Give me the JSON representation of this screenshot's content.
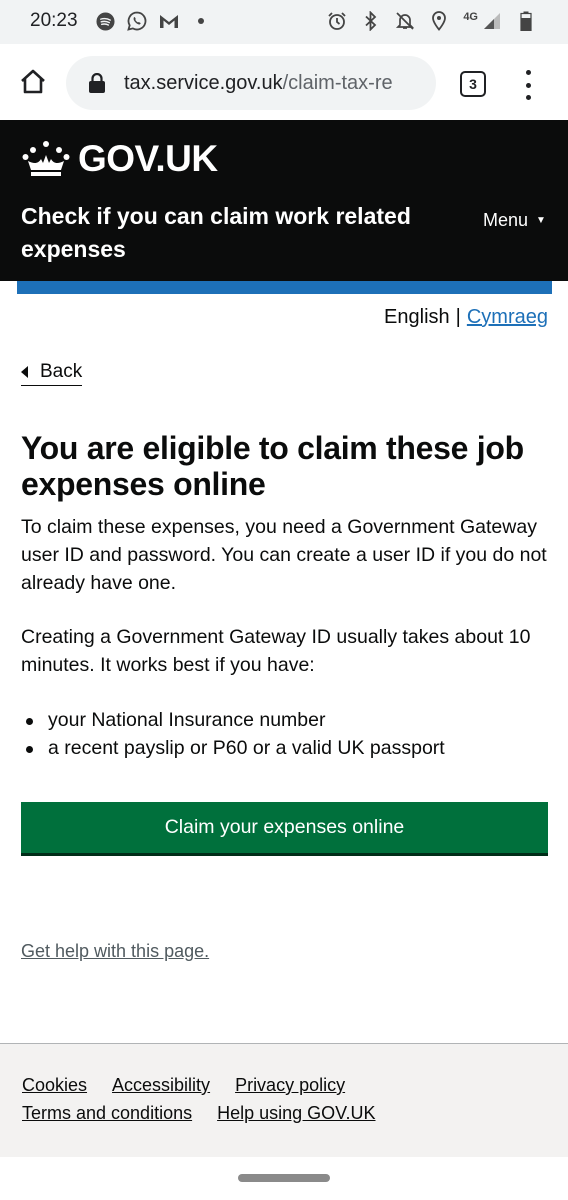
{
  "status_bar": {
    "time": "20:23",
    "network": "4G",
    "battery": "64",
    "left_icons": [
      "spotify-icon",
      "whatsapp-icon",
      "gmail-icon",
      "dot-icon"
    ],
    "right_icons": [
      "alarm-icon",
      "bluetooth-icon",
      "mute-icon",
      "location-icon",
      "signal-icon",
      "battery-icon"
    ]
  },
  "browser": {
    "url_host": "tax.service.gov.uk",
    "url_path": "/claim-tax-re",
    "tab_count": "3"
  },
  "header": {
    "logo_text": "GOV.UK",
    "service_name": "Check if you can claim work related expenses",
    "menu_label": "Menu",
    "accent_color": "#1d70b8"
  },
  "language": {
    "current": "English",
    "separator": "|",
    "other": "Cymraeg"
  },
  "back_label": "Back",
  "main": {
    "heading": "You are eligible to claim these job expenses online",
    "paragraph1": "To claim these expenses, you need a Government Gateway user ID and password. You can create a user ID if you do not already have one.",
    "paragraph2": "Creating a Government Gateway ID usually takes about 10 minutes. It works best if you have:",
    "bullets": [
      "your National Insurance number",
      "a recent payslip or P60 or a valid UK passport"
    ],
    "button_label": "Claim your expenses online",
    "button_color": "#00703c",
    "help_link": "Get help with this page."
  },
  "footer": {
    "links_row1": [
      "Cookies",
      "Accessibility",
      "Privacy policy"
    ],
    "links_row2": [
      "Terms and conditions",
      "Help using GOV.UK"
    ]
  }
}
